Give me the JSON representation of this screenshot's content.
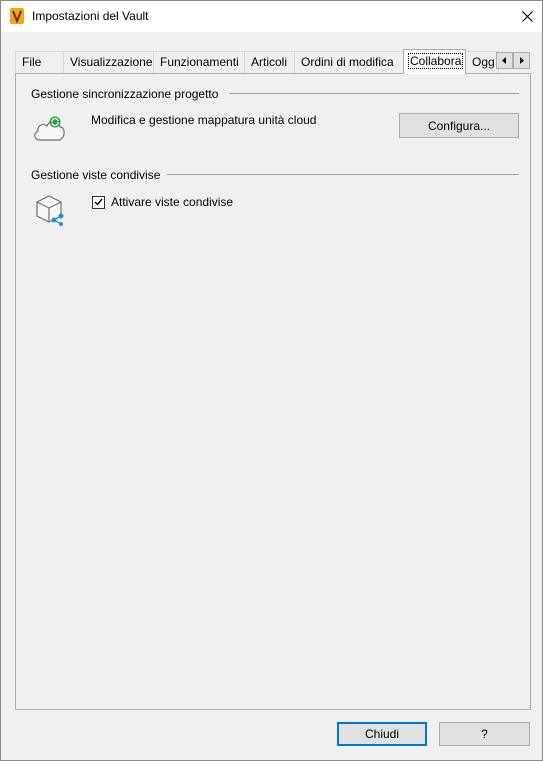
{
  "window": {
    "title": "Impostazioni del Vault"
  },
  "tabs": [
    {
      "label": "File"
    },
    {
      "label": "Visualizzazione"
    },
    {
      "label": "Funzionamenti"
    },
    {
      "label": "Articoli"
    },
    {
      "label": "Ordini di modifica"
    },
    {
      "label": "Collabora"
    },
    {
      "label": "Ogg"
    }
  ],
  "active_tab": "Collabora",
  "sync_group": {
    "header": "Gestione sincronizzazione progetto",
    "description": "Modifica e gestione mappatura unità cloud",
    "button_label": "Configura...",
    "icon": "cloud-sync-icon"
  },
  "shared_views_group": {
    "header": "Gestione viste condivise",
    "checkbox_label": "Attivare viste condivise",
    "checked": true,
    "icon": "shared-cube-icon"
  },
  "footer": {
    "close_label": "Chiudi",
    "help_label": "?"
  },
  "colors": {
    "accent": "#0078d7",
    "sync_arrow": "#2e9e3f",
    "share_blue": "#2b8ce0"
  }
}
